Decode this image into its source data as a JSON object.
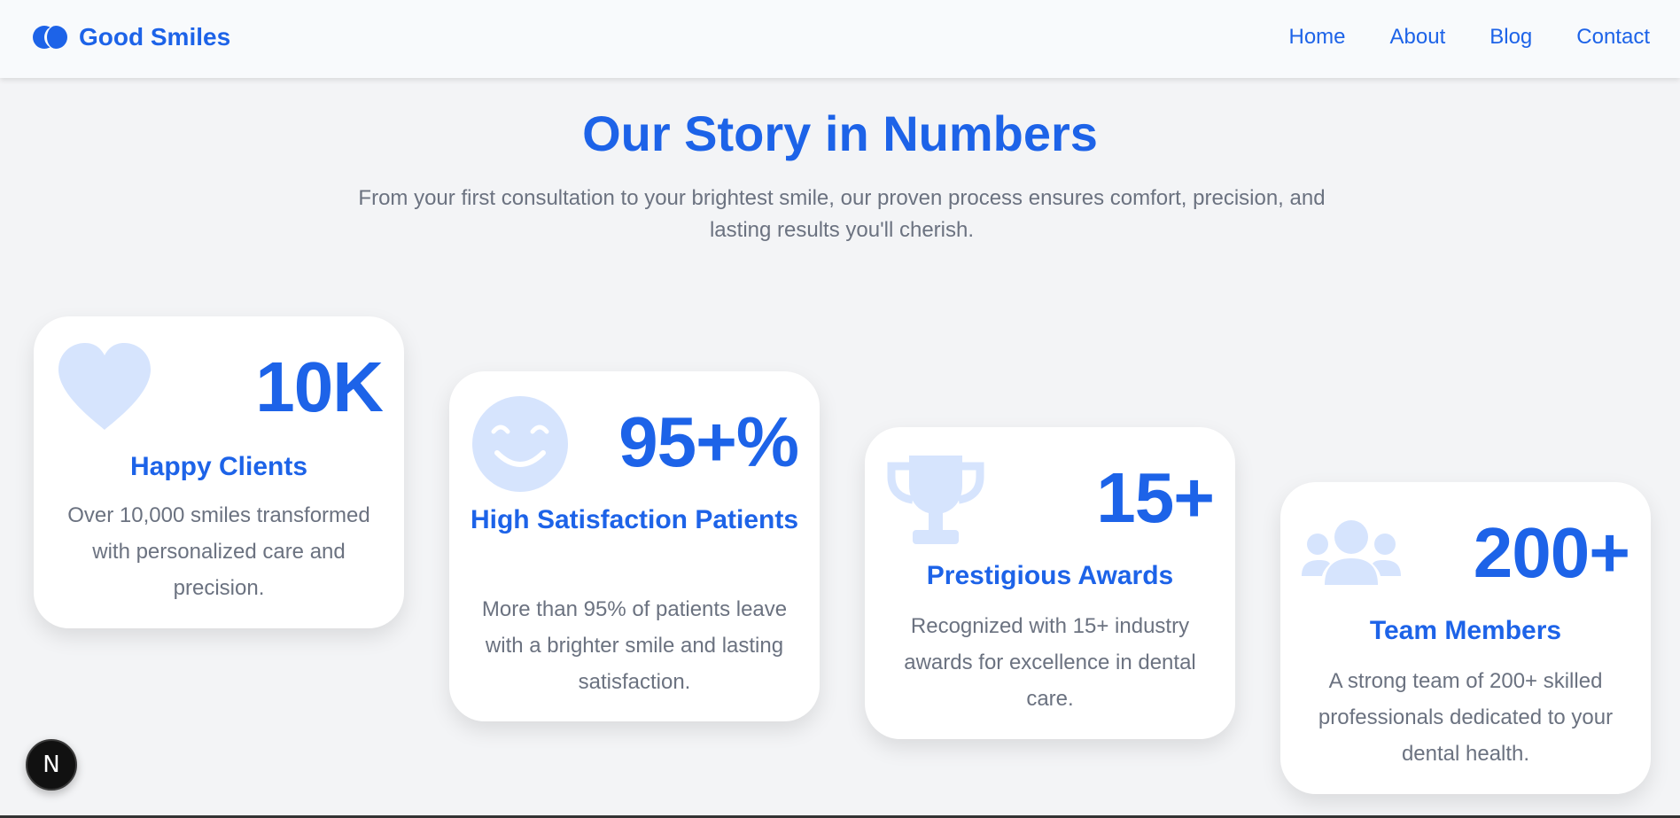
{
  "header": {
    "brand_name": "Good Smiles",
    "nav": [
      "Home",
      "About",
      "Blog",
      "Contact"
    ]
  },
  "hero": {
    "title": "Our Story in Numbers",
    "subtitle": "From your first consultation to your brightest smile, our proven process ensures comfort, precision, and lasting results you'll cherish."
  },
  "stats": [
    {
      "icon": "heart-icon",
      "number": "10K",
      "title": "Happy Clients",
      "description": "Over 10,000 smiles transformed with personalized care and precision."
    },
    {
      "icon": "smile-icon",
      "number": "95+%",
      "title": "High Satisfaction Patients",
      "description": "More than 95% of patients leave with a brighter smile and lasting satisfaction."
    },
    {
      "icon": "trophy-icon",
      "number": "15+",
      "title": "Prestigious Awards",
      "description": "Recognized with 15+ industry awards for excellence in dental care."
    },
    {
      "icon": "users-icon",
      "number": "200+",
      "title": "Team Members",
      "description": "A strong team of 200+ skilled professionals dedicated to your dental health."
    }
  ],
  "dev_indicator": {
    "label": "N"
  },
  "colors": {
    "primary": "#1d63e8",
    "icon_tint": "#d6e4fd",
    "text_muted": "#6b7280",
    "background": "#f3f4f6"
  }
}
